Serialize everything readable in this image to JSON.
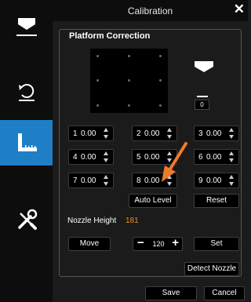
{
  "window": {
    "title": "Calibration"
  },
  "sidebar": {
    "items": [
      {
        "icon": "nozzle-icon",
        "active": false
      },
      {
        "icon": "rotate-icon",
        "active": false
      },
      {
        "icon": "ruler-icon",
        "active": true
      },
      {
        "icon": "tools-icon",
        "active": false
      }
    ]
  },
  "panel": {
    "title": "Platform Correction",
    "nozzle_offset": "0",
    "points": [
      {
        "index": "1",
        "value": "0.00"
      },
      {
        "index": "2",
        "value": "0.00"
      },
      {
        "index": "3",
        "value": "0.00"
      },
      {
        "index": "4",
        "value": "0.00"
      },
      {
        "index": "5",
        "value": "0.00"
      },
      {
        "index": "6",
        "value": "0.00"
      },
      {
        "index": "7",
        "value": "0.00"
      },
      {
        "index": "8",
        "value": "0.00"
      },
      {
        "index": "9",
        "value": "0.00"
      }
    ],
    "auto_level_label": "Auto Level",
    "reset_label": "Reset",
    "nozzle_height_label": "Nozzle Height",
    "nozzle_height_value": "181",
    "move_label": "Move",
    "step_value": "120",
    "minus_label": "−",
    "plus_label": "+",
    "set_label": "Set",
    "detect_nozzle_label": "Detect Nozzle"
  },
  "footer": {
    "save_label": "Save",
    "cancel_label": "Cancel"
  },
  "colors": {
    "accent": "#1f7fc6",
    "highlight": "#e38d2a",
    "annotation_arrow": "#f07a2c"
  }
}
